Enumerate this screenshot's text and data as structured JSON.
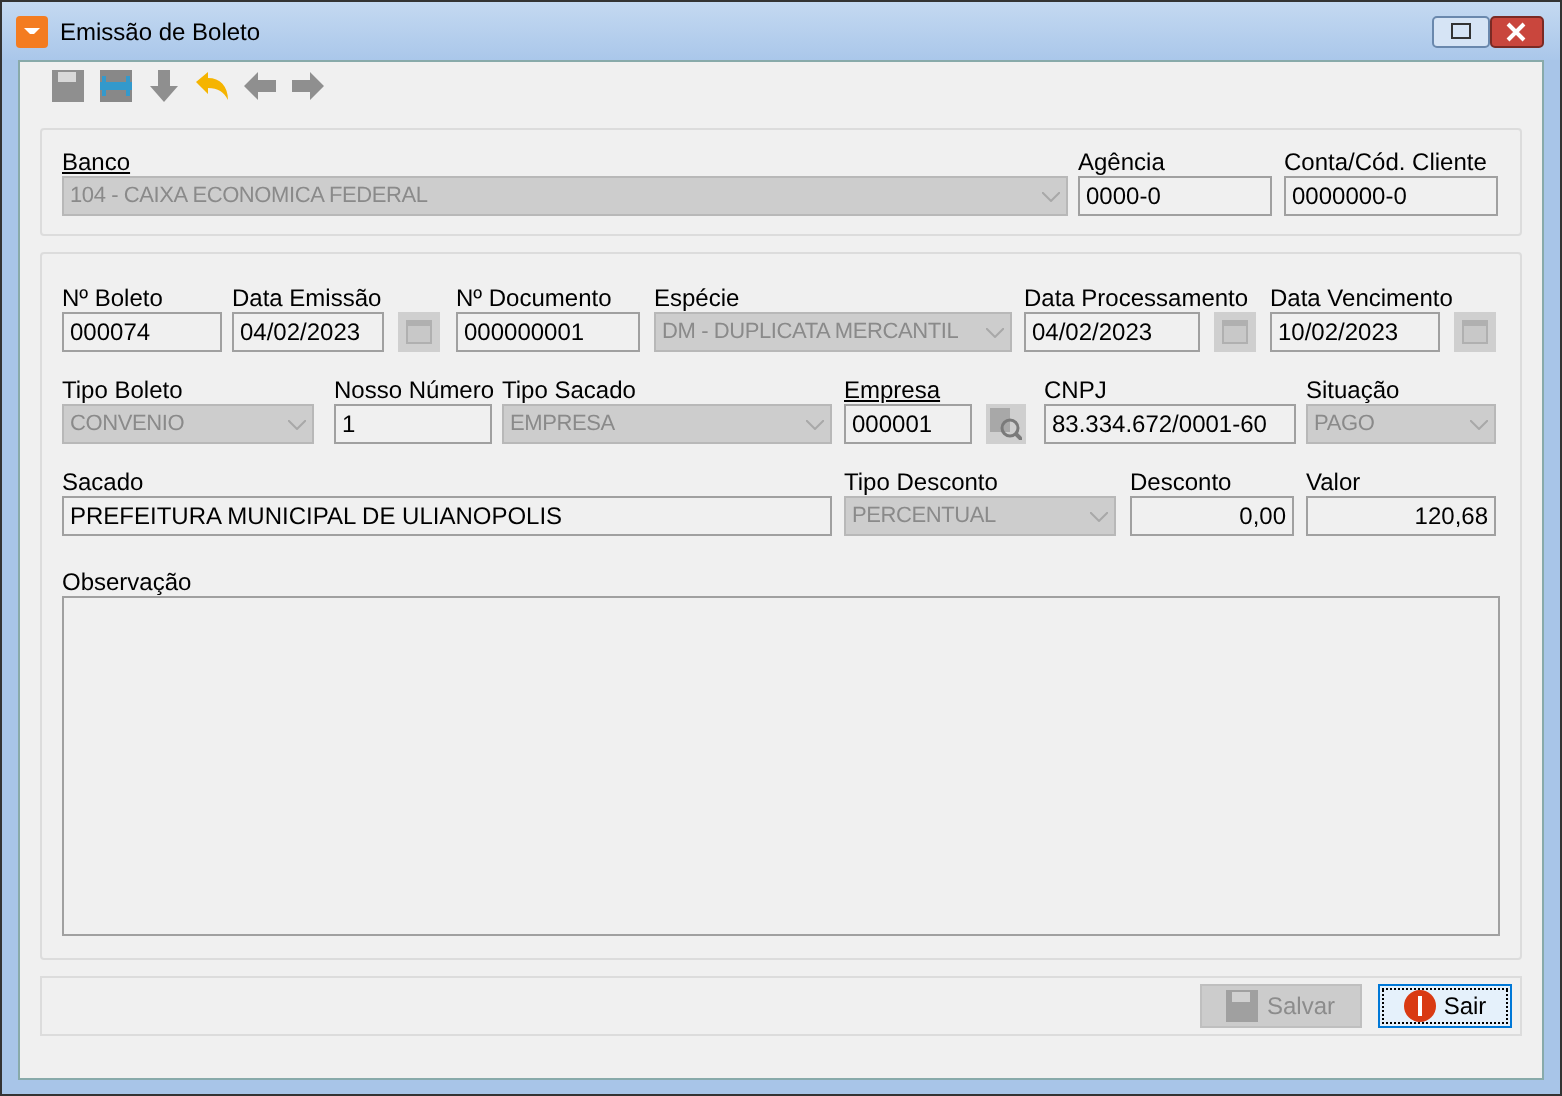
{
  "window": {
    "title": "Emissão de Boleto"
  },
  "toolbar": [
    {
      "kind": "save",
      "disabled": true
    },
    {
      "kind": "save-as",
      "disabled": false
    },
    {
      "kind": "down",
      "disabled": true
    },
    {
      "kind": "undo",
      "disabled": false
    },
    {
      "kind": "left",
      "disabled": true
    },
    {
      "kind": "right",
      "disabled": true
    }
  ],
  "bank_group": [
    {
      "label": "Banco",
      "link": true,
      "kind": "combo",
      "value": "104 - CAIXA ECONOMICA FEDERAL"
    },
    {
      "label": "Agência",
      "link": false,
      "kind": "text",
      "value": "0000-0"
    },
    {
      "label": "Conta/Cód. Cliente",
      "link": false,
      "kind": "text",
      "value": "0000000-0"
    }
  ],
  "rows": [
    [
      {
        "label": "Nº Boleto",
        "link": false,
        "kind": "text",
        "value": "000074"
      },
      {
        "label": "Data Emissão",
        "link": false,
        "kind": "date",
        "value": "04/02/2023"
      },
      {
        "label": "Nº Documento",
        "link": false,
        "kind": "text",
        "value": "000000001"
      },
      {
        "label": "Espécie",
        "link": false,
        "kind": "combo",
        "value": "DM - DUPLICATA MERCANTIL"
      },
      {
        "label": "Data Processamento",
        "link": false,
        "kind": "date",
        "value": "04/02/2023"
      },
      {
        "label": "Data Vencimento",
        "link": false,
        "kind": "date",
        "value": "10/02/2023"
      }
    ],
    [
      {
        "label": "Tipo Boleto",
        "link": false,
        "kind": "combo",
        "value": "CONVENIO"
      },
      {
        "label": "Nosso Número",
        "link": false,
        "kind": "text",
        "value": "1"
      },
      {
        "label": "Tipo Sacado",
        "link": false,
        "kind": "combo",
        "value": "EMPRESA"
      },
      {
        "label": "Empresa",
        "link": true,
        "kind": "lookup",
        "value": "000001"
      },
      {
        "label": "CNPJ",
        "link": false,
        "kind": "text",
        "value": "83.334.672/0001-60"
      },
      {
        "label": "Situação",
        "link": false,
        "kind": "combo",
        "value": "PAGO"
      }
    ],
    [
      {
        "label": "Sacado",
        "link": false,
        "kind": "text",
        "value": "PREFEITURA MUNICIPAL DE ULIANOPOLIS"
      },
      {
        "label": "Tipo Desconto",
        "link": false,
        "kind": "combo",
        "value": "PERCENTUAL"
      },
      {
        "label": "Desconto",
        "link": false,
        "kind": "number",
        "value": "0,00"
      },
      {
        "label": "Valor",
        "link": false,
        "kind": "number",
        "value": "120,68"
      }
    ]
  ],
  "observation": {
    "label": "Observação"
  },
  "buttons": [
    {
      "kind": "save",
      "label": "Salvar",
      "disabled": true
    },
    {
      "kind": "exit",
      "label": "Sair",
      "disabled": false
    }
  ]
}
